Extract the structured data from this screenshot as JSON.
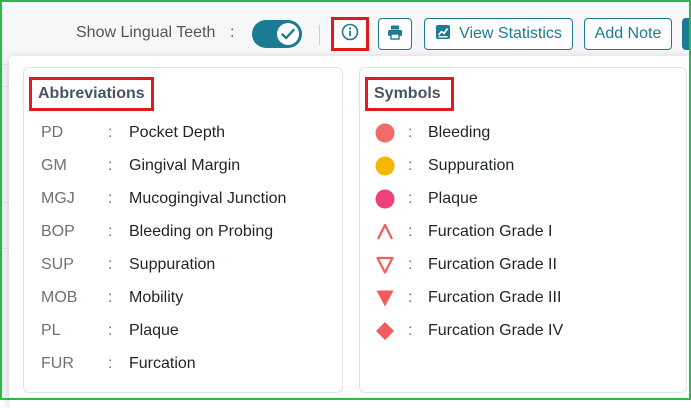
{
  "toolbar": {
    "lingual_label": "Show Lingual Teeth",
    "lingual_colon": ":",
    "lingual_on": true,
    "stats_label": "View Statistics",
    "note_label": "Add Note"
  },
  "abbreviations": {
    "title": "Abbreviations",
    "items": [
      {
        "abbr": "PD",
        "meaning": "Pocket Depth"
      },
      {
        "abbr": "GM",
        "meaning": "Gingival Margin"
      },
      {
        "abbr": "MGJ",
        "meaning": "Mucogingival Junction"
      },
      {
        "abbr": "BOP",
        "meaning": "Bleeding on Probing"
      },
      {
        "abbr": "SUP",
        "meaning": "Suppuration"
      },
      {
        "abbr": "MOB",
        "meaning": "Mobility"
      },
      {
        "abbr": "PL",
        "meaning": "Plaque"
      },
      {
        "abbr": "FUR",
        "meaning": "Furcation"
      }
    ]
  },
  "symbols": {
    "title": "Symbols",
    "items": [
      {
        "icon": "bleeding-dot-icon",
        "color": "#f26a6a",
        "label": "Bleeding"
      },
      {
        "icon": "suppuration-dot-icon",
        "color": "#f5b800",
        "label": "Suppuration"
      },
      {
        "icon": "plaque-dot-icon",
        "color": "#f0427a",
        "label": "Plaque"
      },
      {
        "icon": "furcation-grade-1-icon",
        "color": "#f25c5c",
        "label": "Furcation Grade I"
      },
      {
        "icon": "furcation-grade-2-icon",
        "color": "#f25c5c",
        "label": "Furcation Grade II"
      },
      {
        "icon": "furcation-grade-3-icon",
        "color": "#f25c5c",
        "label": "Furcation Grade III"
      },
      {
        "icon": "furcation-grade-4-icon",
        "color": "#f25c5c",
        "label": "Furcation Grade IV"
      }
    ]
  },
  "colors": {
    "accent": "#1d7a93",
    "highlight": "#e01b1b"
  }
}
